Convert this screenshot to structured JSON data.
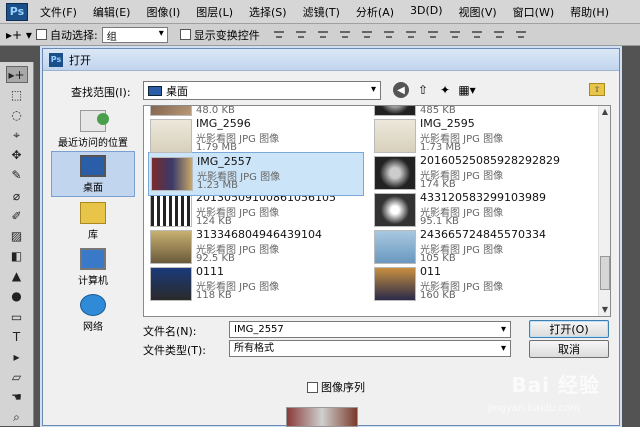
{
  "app": {
    "logo": "Ps",
    "menu": [
      "文件(F)",
      "编辑(E)",
      "图像(I)",
      "图层(L)",
      "选择(S)",
      "滤镜(T)",
      "分析(A)",
      "3D(D)",
      "视图(V)",
      "窗口(W)",
      "帮助(H)"
    ]
  },
  "options": {
    "tool_glyph": "▸+ ▾",
    "auto_select_label": "自动选择:",
    "auto_select_value": "组",
    "show_transform_label": "显示变换控件"
  },
  "tools": [
    "▸+",
    "⬚",
    "◌",
    "⌖",
    "✥",
    "✎",
    "⌀",
    "✐",
    "▨",
    "◧",
    "▲",
    "●",
    "▭",
    "T",
    "▸",
    "▱",
    "☚",
    "⌕"
  ],
  "dialog": {
    "title": "打开",
    "look_in_label": "查找范围(I):",
    "look_in_value": "桌面",
    "places": [
      {
        "label": "最近访问的位置",
        "icon": "recent-places-icon"
      },
      {
        "label": "桌面",
        "icon": "desktop-icon"
      },
      {
        "label": "库",
        "icon": "library-icon"
      },
      {
        "label": "计算机",
        "icon": "computer-icon"
      },
      {
        "label": "网络",
        "icon": "network-icon"
      }
    ],
    "files": [
      {
        "name": "",
        "type": "",
        "size": "48.0 KB",
        "thumb": "t0"
      },
      {
        "name": "",
        "type": "",
        "size": "485 KB",
        "thumb": "t4"
      },
      {
        "name": "IMG_2596",
        "type": "光影看图 JPG 图像",
        "size": "1.79 MB",
        "thumb": "t1"
      },
      {
        "name": "IMG_2595",
        "type": "光影看图 JPG 图像",
        "size": "1.73 MB",
        "thumb": "t1"
      },
      {
        "name": "IMG_2557",
        "type": "光影看图 JPG 图像",
        "size": "1.23 MB",
        "thumb": "t3",
        "selected": true
      },
      {
        "name": "20160525085928292829",
        "type": "光影看图 JPG 图像",
        "size": "174 KB",
        "thumb": "t4"
      },
      {
        "name": "20130509100861056105",
        "type": "光影看图 JPG 图像",
        "size": "124 KB",
        "thumb": "t5"
      },
      {
        "name": "433120583299103989",
        "type": "光影看图 JPG 图像",
        "size": "95.1 KB",
        "thumb": "t6"
      },
      {
        "name": "313346804946439104",
        "type": "光影看图 JPG 图像",
        "size": "92.5 KB",
        "thumb": "t7"
      },
      {
        "name": "243665724845570334",
        "type": "光影看图 JPG 图像",
        "size": "105 KB",
        "thumb": "t8"
      },
      {
        "name": "0111",
        "type": "光影看图 JPG 图像",
        "size": "118 KB",
        "thumb": "t9"
      },
      {
        "name": "011",
        "type": "光影看图 JPG 图像",
        "size": "160 KB",
        "thumb": "t10"
      }
    ],
    "filename_label": "文件名(N):",
    "filename_value": "IMG_2557",
    "filetype_label": "文件类型(T):",
    "filetype_value": "所有格式",
    "open_button": "打开(O)",
    "cancel_button": "取消",
    "sequence_label": "图像序列"
  },
  "watermark": {
    "brand": "Bai 经验",
    "url": "jingyan.baidu.com"
  }
}
